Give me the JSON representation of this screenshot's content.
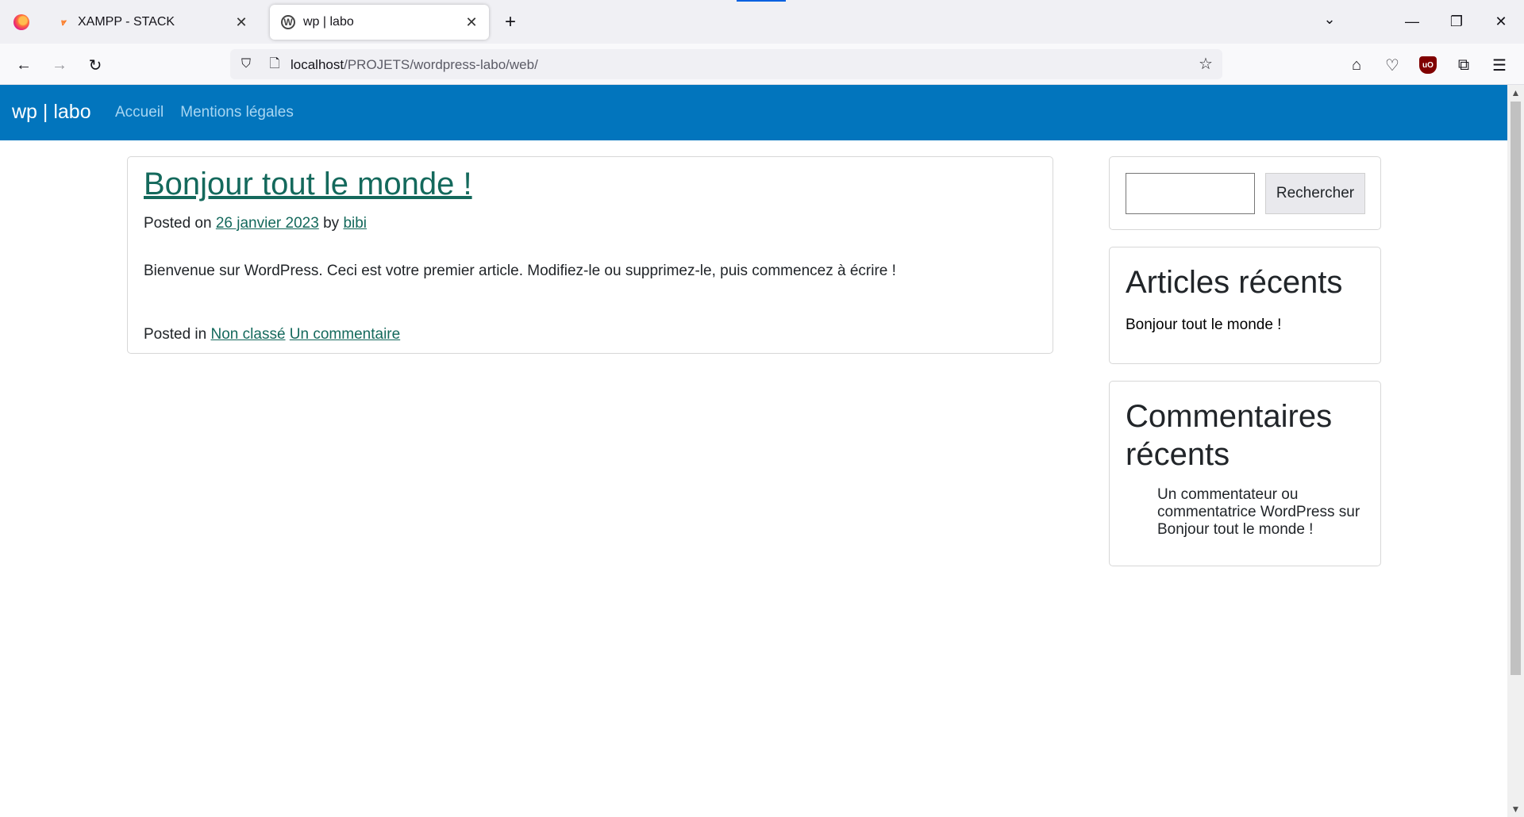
{
  "browser": {
    "tabs": [
      {
        "title": "XAMPP - STACK",
        "icon": "xampp-icon",
        "active": false
      },
      {
        "title": "wp | labo",
        "icon": "wordpress-icon",
        "active": true
      }
    ],
    "new_tab_symbol": "+",
    "url_host": "localhost",
    "url_path": "/PROJETS/wordpress-labo/web/",
    "icons": {
      "back": "arrow-left-icon",
      "forward": "arrow-right-icon",
      "reload": "reload-icon",
      "shield": "shield-icon",
      "page": "page-icon",
      "bookmark": "star-icon",
      "home": "home-icon",
      "pocket": "pocket-icon",
      "ublock": "ublock-origin-icon",
      "extensions": "puzzle-icon",
      "menu": "hamburger-menu-icon"
    },
    "ublock_label": "uO"
  },
  "site": {
    "brand": "wp | labo",
    "nav": [
      "Accueil",
      "Mentions légales"
    ],
    "header_color": "#0275bd"
  },
  "article": {
    "title": "Bonjour tout le monde !",
    "posted_on_label": "Posted on",
    "date": "26 janvier 2023",
    "by_label": "by",
    "author": "bibi",
    "excerpt": "Bienvenue sur WordPress. Ceci est votre premier article. Modifiez-le ou supprimez-le, puis commencez à écrire !",
    "posted_in_label": "Posted in",
    "category": "Non classé",
    "comments_link": "Un commentaire"
  },
  "sidebar": {
    "search": {
      "input_value": "",
      "button_label": "Rechercher"
    },
    "recent_posts": {
      "title": "Articles récents",
      "items": [
        "Bonjour tout le monde !"
      ]
    },
    "recent_comments": {
      "title": "Commentaires récents",
      "author": "Un commentateur ou commentatrice WordPress",
      "on_label": "sur",
      "post": "Bonjour tout le monde !"
    }
  },
  "link_color": "#14695c"
}
